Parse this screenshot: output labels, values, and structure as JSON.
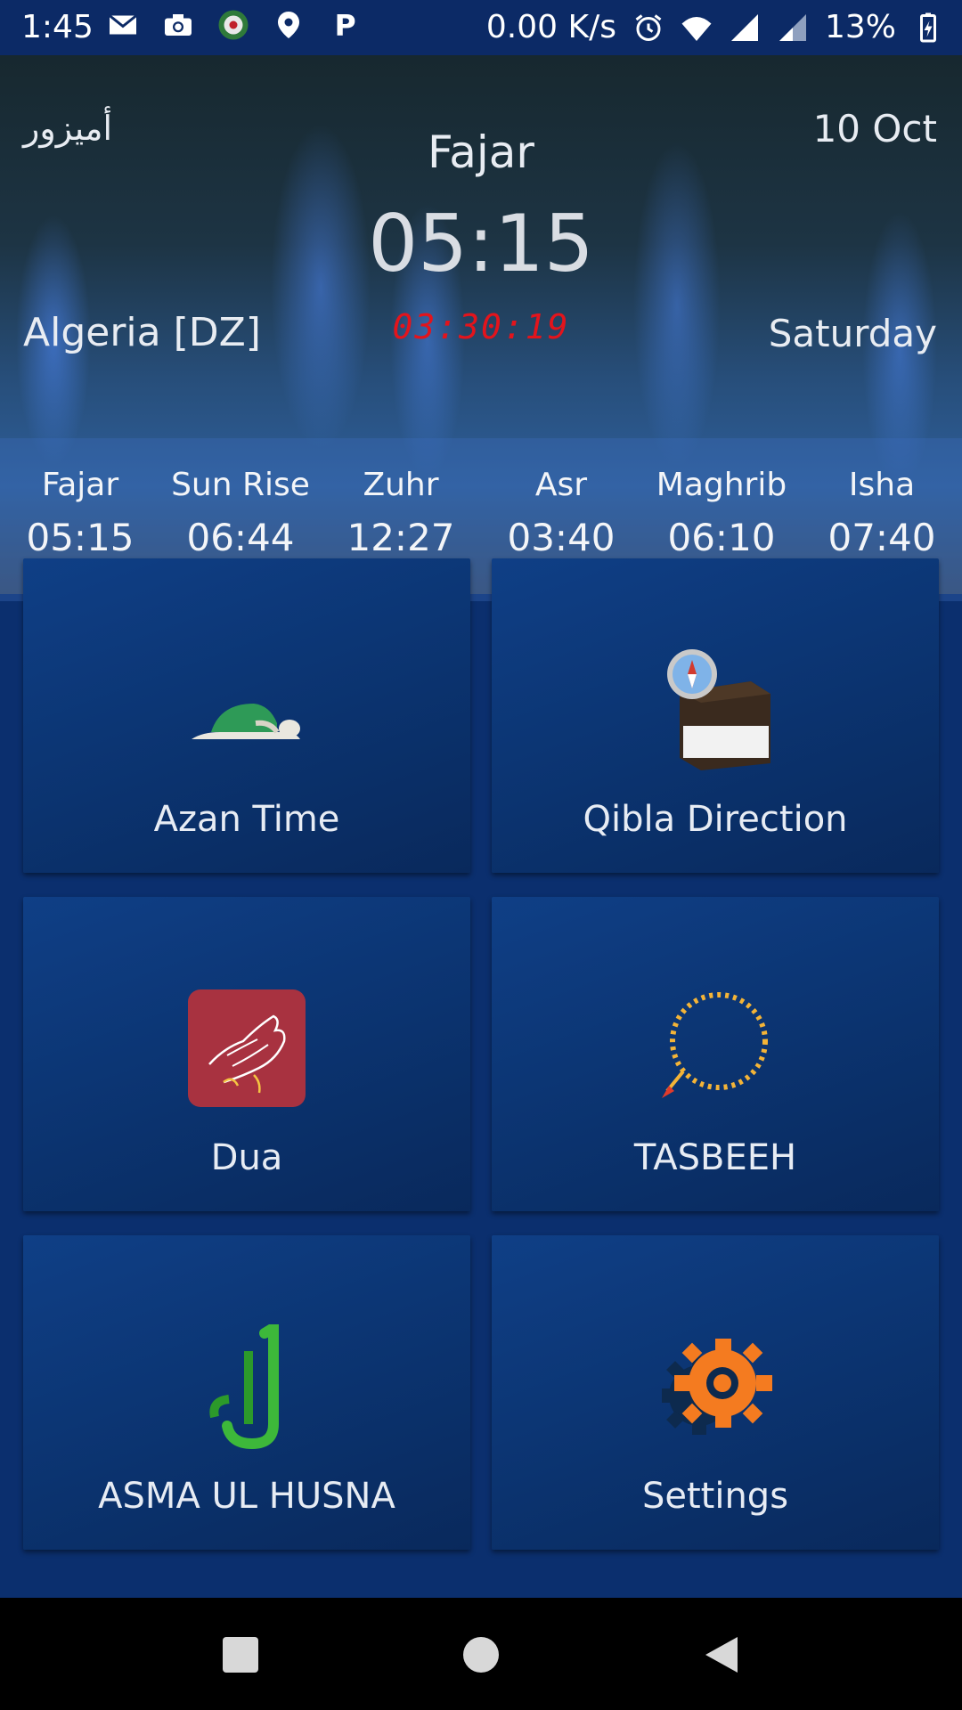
{
  "status_bar": {
    "time": "1:45",
    "net_speed": "0.00 K/s",
    "battery": "13%"
  },
  "header": {
    "city": "أميزور",
    "date": "10 Oct",
    "next_prayer_name": "Fajar",
    "next_prayer_time": "05:15",
    "country": "Algeria [DZ]",
    "countdown": "03:30:19",
    "weekday": "Saturday"
  },
  "prayer_times": [
    {
      "name": "Fajar",
      "time": "05:15"
    },
    {
      "name": "Sun Rise",
      "time": "06:44"
    },
    {
      "name": "Zuhr",
      "time": "12:27"
    },
    {
      "name": "Asr",
      "time": "03:40"
    },
    {
      "name": "Maghrib",
      "time": "06:10"
    },
    {
      "name": "Isha",
      "time": "07:40"
    }
  ],
  "menu": [
    {
      "label": "Azan Time",
      "icon": "prayer-mat-icon"
    },
    {
      "label": "Qibla Direction",
      "icon": "kaaba-compass-icon"
    },
    {
      "label": "Dua",
      "icon": "praying-hands-icon"
    },
    {
      "label": "TASBEEH",
      "icon": "prayer-beads-icon"
    },
    {
      "label": "ASMA UL HUSNA",
      "icon": "allah-calligraphy-icon"
    },
    {
      "label": "Settings",
      "icon": "gear-icon"
    }
  ],
  "colors": {
    "countdown": "#e3141c",
    "card": "#0f3f86",
    "settings_orange": "#f47b20"
  }
}
